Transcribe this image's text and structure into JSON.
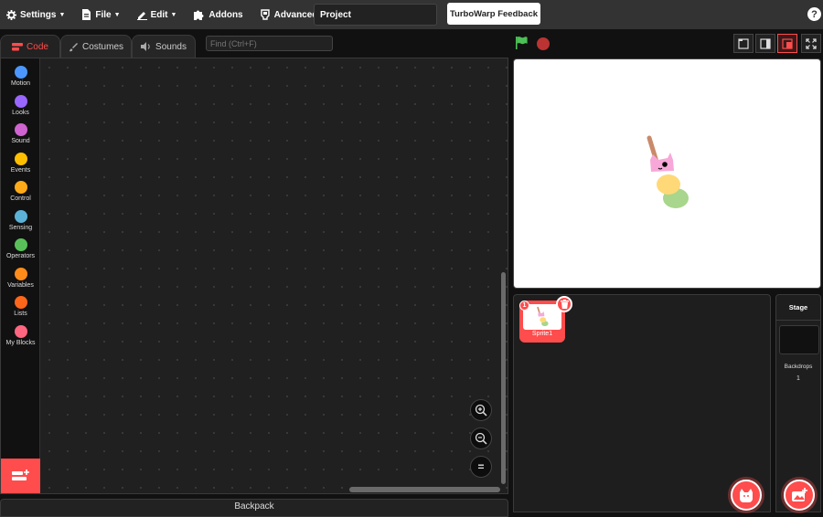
{
  "menubar": {
    "settings_label": "Settings",
    "file_label": "File",
    "edit_label": "Edit",
    "addons_label": "Addons",
    "advanced_label": "Advanced",
    "project_title": "Project",
    "feedback_label": "TurboWarp Feedback",
    "help_label": "?"
  },
  "tabs": {
    "code_label": "Code",
    "costumes_label": "Costumes",
    "sounds_label": "Sounds"
  },
  "search": {
    "placeholder": "Find (Ctrl+F)"
  },
  "categories": [
    {
      "label": "Motion",
      "color": "#4c97ff"
    },
    {
      "label": "Looks",
      "color": "#9966ff"
    },
    {
      "label": "Sound",
      "color": "#cf63cf"
    },
    {
      "label": "Events",
      "color": "#ffbf00"
    },
    {
      "label": "Control",
      "color": "#ffab19"
    },
    {
      "label": "Sensing",
      "color": "#5cb1d6"
    },
    {
      "label": "Operators",
      "color": "#59c059"
    },
    {
      "label": "Variables",
      "color": "#ff8c1a"
    },
    {
      "label": "Lists",
      "color": "#ff661a"
    },
    {
      "label": "My Blocks",
      "color": "#ff6680"
    }
  ],
  "zoom": {
    "reset_label": "="
  },
  "backpack": {
    "label": "Backpack"
  },
  "sprites": [
    {
      "name": "Sprite1",
      "index": "1"
    }
  ],
  "stage_panel": {
    "title": "Stage",
    "backdrops_label": "Backdrops",
    "backdrops_count": "1"
  },
  "colors": {
    "accent": "#ff4c4c",
    "flag": "#4cbf56",
    "menubar": "#333333"
  }
}
